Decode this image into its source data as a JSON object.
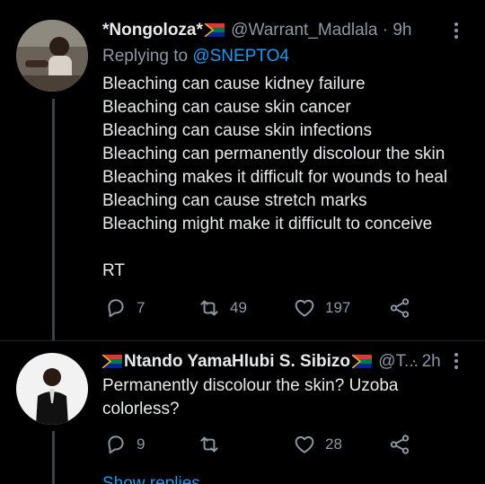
{
  "tweet1": {
    "display_name": "*Nongoloza*",
    "handle": "@Warrant_Madlala",
    "time": "· 9h",
    "replying_prefix": "Replying to",
    "replying_handle": "@SNEPTO4",
    "lines": [
      "Bleaching can cause kidney failure",
      "Bleaching can cause skin cancer",
      "Bleaching can cause skin infections",
      "Bleaching can permanently discolour the skin",
      "Bleaching makes it difficult for wounds to heal",
      "Bleaching can cause stretch marks",
      "Bleaching might make it difficult to conceive",
      "",
      "RT"
    ],
    "replies": "7",
    "retweets": "49",
    "likes": "197"
  },
  "tweet2": {
    "display_name": "Ntando YamaHlubi S. Sibizo",
    "handle": "@T...",
    "time": "· 2h",
    "lines": [
      "Permanently discolour the skin? Uzoba",
      "colorless?"
    ],
    "replies": "9",
    "retweets": "",
    "likes": "28"
  },
  "show_more": "Show replies",
  "icons": [
    "reply-icon",
    "retweet-icon",
    "like-icon",
    "share-icon",
    "more-options-icon",
    "south-africa-flag-icon"
  ]
}
